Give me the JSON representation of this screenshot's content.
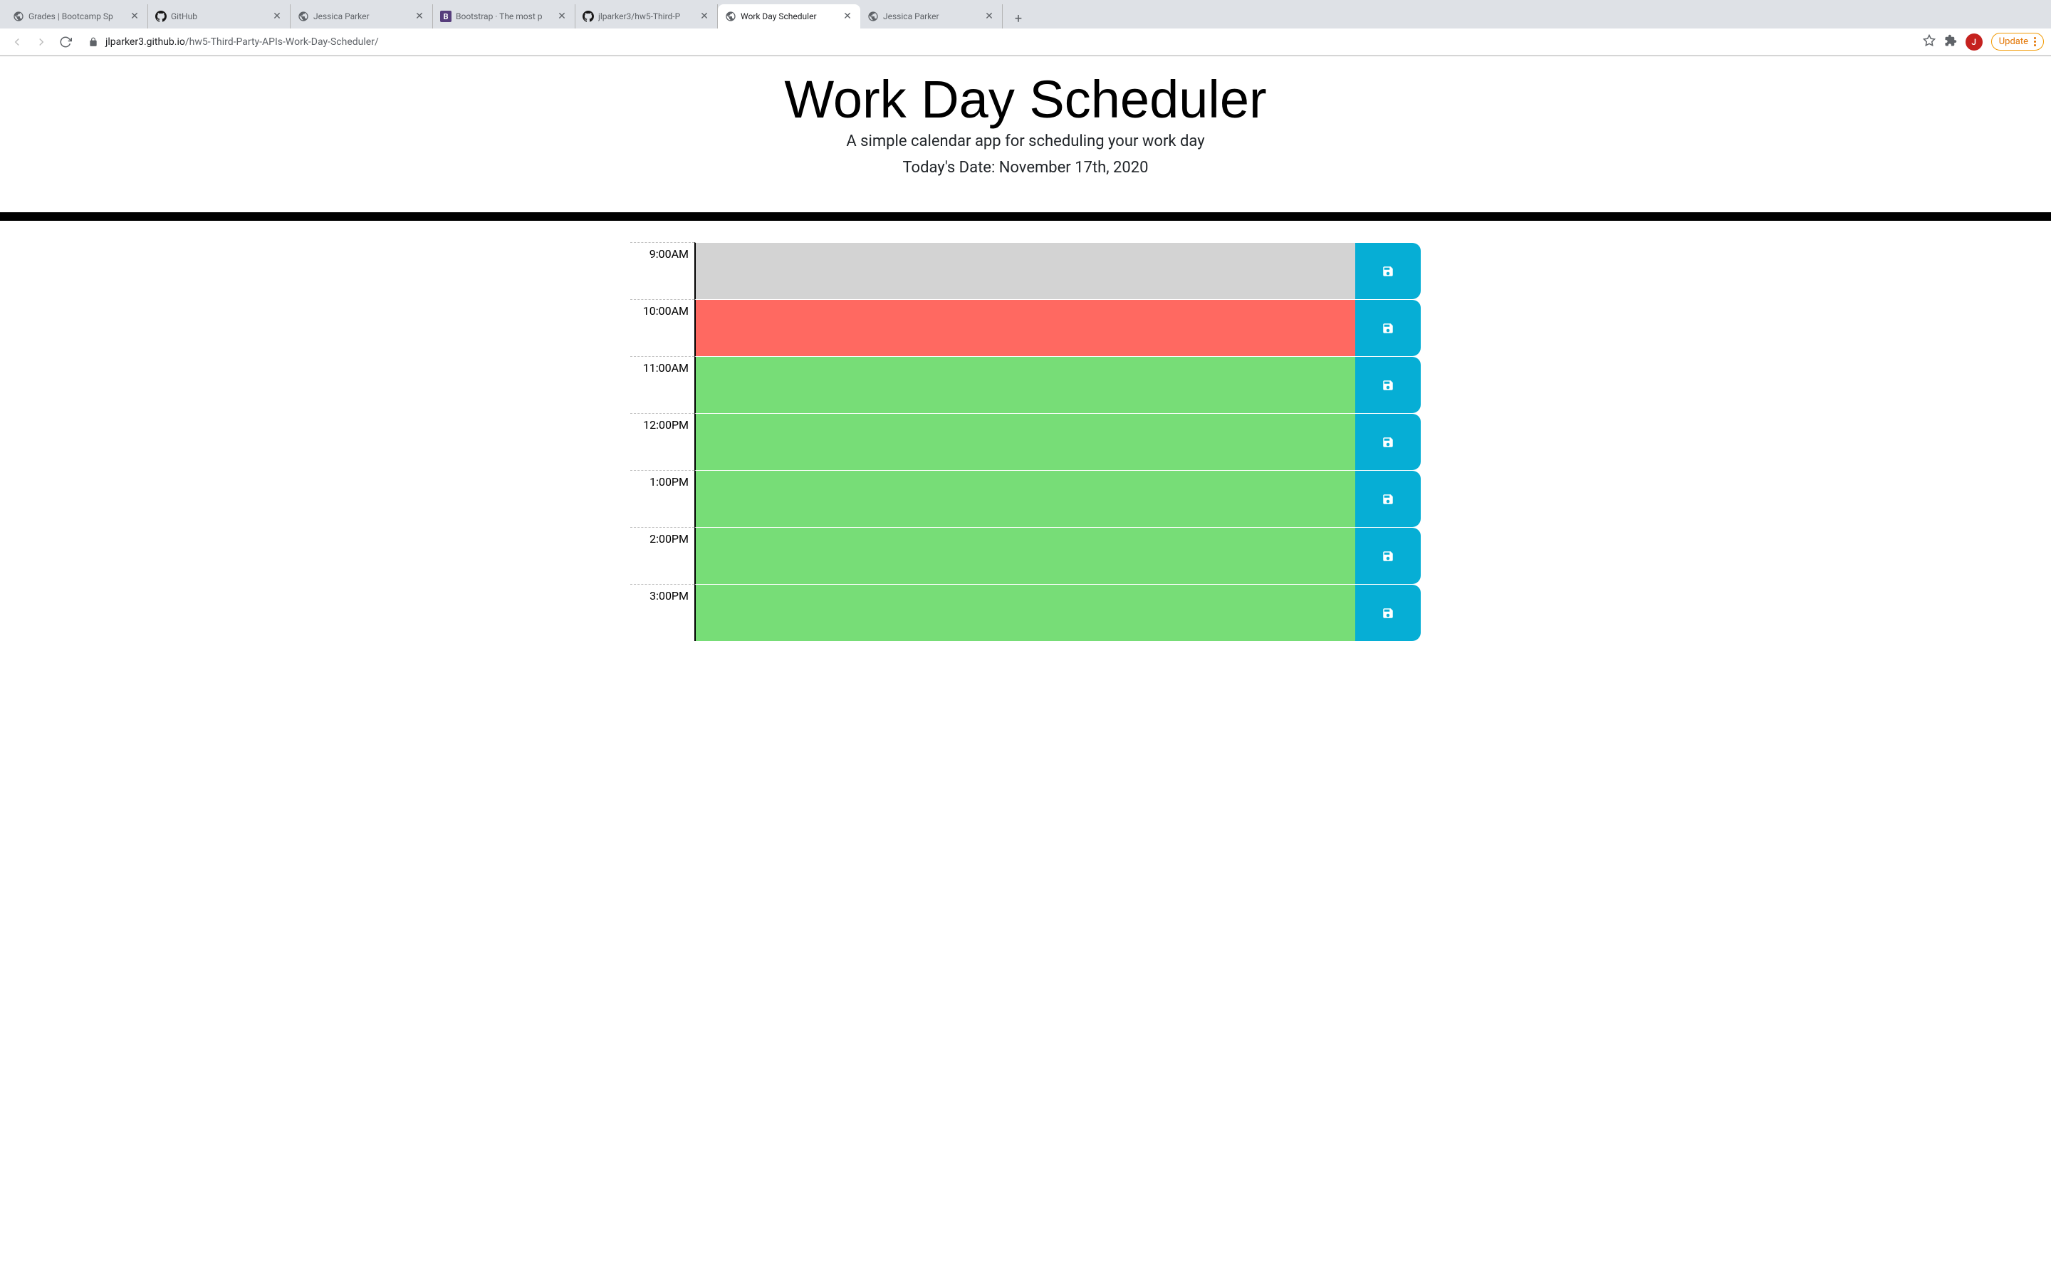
{
  "browser": {
    "tabs": [
      {
        "title": "Grades | Bootcamp Sp",
        "favicon": "globe"
      },
      {
        "title": "GitHub",
        "favicon": "github"
      },
      {
        "title": "Jessica Parker",
        "favicon": "globe"
      },
      {
        "title": "Bootstrap · The most p",
        "favicon": "bootstrap"
      },
      {
        "title": "jlparker3/hw5-Third-P",
        "favicon": "github"
      },
      {
        "title": "Work Day Scheduler",
        "favicon": "globe",
        "active": true
      },
      {
        "title": "Jessica Parker",
        "favicon": "globe"
      }
    ],
    "url_domain": "jlparker3.github.io",
    "url_path": "/hw5-Third-Party-APIs-Work-Day-Scheduler/",
    "profile_letter": "J",
    "update_label": "Update"
  },
  "page": {
    "title": "Work Day Scheduler",
    "lead": "A simple calendar app for scheduling your work day",
    "date": "Today's Date: November 17th, 2020",
    "timeblocks": [
      {
        "hour": "9:00AM",
        "state": "past",
        "value": ""
      },
      {
        "hour": "10:00AM",
        "state": "present",
        "value": ""
      },
      {
        "hour": "11:00AM",
        "state": "future",
        "value": ""
      },
      {
        "hour": "12:00PM",
        "state": "future",
        "value": ""
      },
      {
        "hour": "1:00PM",
        "state": "future",
        "value": ""
      },
      {
        "hour": "2:00PM",
        "state": "future",
        "value": ""
      },
      {
        "hour": "3:00PM",
        "state": "future",
        "value": ""
      }
    ]
  }
}
